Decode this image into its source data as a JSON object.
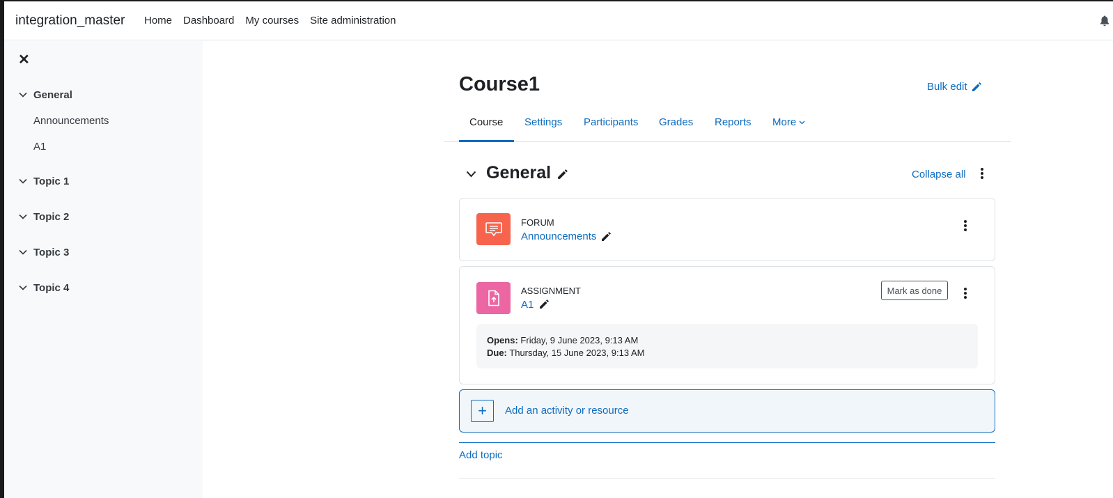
{
  "navbar": {
    "brand": "integration_master",
    "links": [
      "Home",
      "Dashboard",
      "My courses",
      "Site administration"
    ]
  },
  "drawer": {
    "close_glyph": "✕",
    "sections": [
      {
        "title": "General",
        "items": [
          "Announcements",
          "A1"
        ]
      },
      {
        "title": "Topic 1",
        "items": []
      },
      {
        "title": "Topic 2",
        "items": []
      },
      {
        "title": "Topic 3",
        "items": []
      },
      {
        "title": "Topic 4",
        "items": []
      }
    ]
  },
  "course": {
    "title": "Course1",
    "bulk_edit": "Bulk edit",
    "tabs": [
      "Course",
      "Settings",
      "Participants",
      "Grades",
      "Reports",
      "More"
    ],
    "active_tab": "Course"
  },
  "section": {
    "title": "General",
    "collapse_all": "Collapse all",
    "activities": [
      {
        "type": "FORUM",
        "name": "Announcements",
        "icon": "forum-icon",
        "color": "#f7634d"
      },
      {
        "type": "ASSIGNMENT",
        "name": "A1",
        "icon": "assignment-icon",
        "color": "#eb66a2",
        "mark_done": "Mark as done",
        "opens_label": "Opens:",
        "opens_value": "Friday, 9 June 2023, 9:13 AM",
        "due_label": "Due:",
        "due_value": "Thursday, 15 June 2023, 9:13 AM"
      }
    ],
    "add_activity": "Add an activity or resource",
    "add_topic": "Add topic"
  },
  "colors": {
    "link": "#0f6cbf",
    "text": "#1d2125",
    "drawer_bg": "#f8f9fa"
  }
}
